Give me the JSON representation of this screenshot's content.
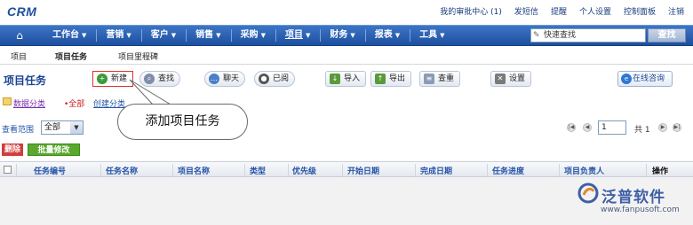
{
  "app": {
    "logo": "CRM"
  },
  "top_links": [
    "我的审批中心 (1)",
    "发短信",
    "提醒",
    "个人设置",
    "控制面板",
    "注销"
  ],
  "main_nav": {
    "items": [
      {
        "label": "工作台"
      },
      {
        "label": "营销"
      },
      {
        "label": "客户"
      },
      {
        "label": "销售"
      },
      {
        "label": "采购"
      },
      {
        "label": "项目"
      },
      {
        "label": "财务"
      },
      {
        "label": "报表"
      },
      {
        "label": "工具"
      }
    ],
    "search_value": "快速查找",
    "search_button": "查找"
  },
  "sub_nav": [
    "项目",
    "项目任务",
    "项目里程碑"
  ],
  "page_title": "项目任务",
  "toolbar": {
    "new": "新建",
    "find": "查找",
    "chat": "聊天",
    "read": "已阅",
    "import": "导入",
    "export": "导出",
    "dedupe": "查重",
    "settings": "设置",
    "consult": "在线咨询"
  },
  "category": {
    "label": "数据分类",
    "all": "•全部",
    "create": "创建分类"
  },
  "tooltip": "添加项目任务",
  "filter": {
    "scope_label": "查看范围",
    "scope_value": "全部"
  },
  "pager": {
    "page": "1",
    "total_text": "共 1"
  },
  "actions": {
    "delete": "删除",
    "batch_edit": "批量修改"
  },
  "table": {
    "columns": [
      "任务编号",
      "任务名称",
      "项目名称",
      "类型",
      "优先级",
      "开始日期",
      "完成日期",
      "任务进度",
      "项目负责人",
      "操作"
    ]
  },
  "watermark": {
    "brand": "泛普软件",
    "url": "www.fanpusoft.com"
  },
  "colors": {
    "nav_blue": "#1d4f9f",
    "title_blue": "#1a4690",
    "delete_red": "#d23c3c",
    "batch_green": "#5aa82e"
  }
}
